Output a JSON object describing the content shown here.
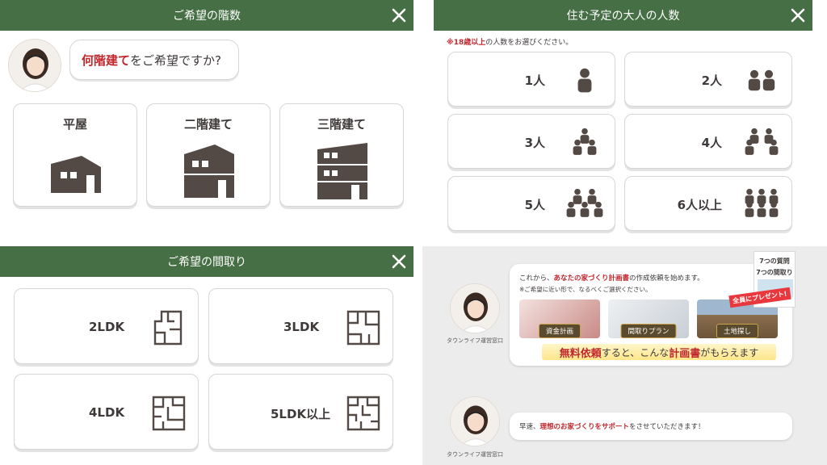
{
  "floors_panel": {
    "title": "ご希望の階数",
    "question_highlight": "何階建て",
    "question_rest": "をご希望ですか?",
    "options": [
      {
        "label": "平屋",
        "icon": "one-story-house-icon"
      },
      {
        "label": "二階建て",
        "icon": "two-story-house-icon"
      },
      {
        "label": "三階建て",
        "icon": "three-story-house-icon"
      }
    ]
  },
  "adults_panel": {
    "title": "住む予定の大人の人数",
    "note_highlight": "※18歳以上",
    "note_rest": "の人数をお選びください。",
    "options": [
      {
        "label": "1人",
        "count": 1
      },
      {
        "label": "2人",
        "count": 2
      },
      {
        "label": "3人",
        "count": 3
      },
      {
        "label": "4人",
        "count": 4
      },
      {
        "label": "5人",
        "count": 5
      },
      {
        "label": "6人以上",
        "count": 6
      }
    ]
  },
  "layout_panel": {
    "title": "ご希望の間取り",
    "options": [
      {
        "label": "2LDK"
      },
      {
        "label": "3LDK"
      },
      {
        "label": "4LDK"
      },
      {
        "label": "5LDK以上"
      }
    ]
  },
  "chat_panel": {
    "message1_pre": "これから、",
    "message1_highlight": "あなたの家づくり計画書",
    "message1_post": "の作成依頼を始めます。",
    "message1_note": "※ご希望に近い形で、なるべくご選択ください。",
    "photos": [
      {
        "label": "資金計画"
      },
      {
        "label": "間取りプラン"
      },
      {
        "label": "土地探し"
      }
    ],
    "banner_highlight1": "無料依頼",
    "banner_mid": "すると、こんな",
    "banner_highlight2": "計画書",
    "banner_end": "がもらえます",
    "book_line1": "7つの質問",
    "book_line2": "7つの間取り",
    "present_text": "全員にプレゼント!",
    "agent_caption": "タウンライフ運営窓口",
    "message2_pre": "早速、",
    "message2_highlight": "理想のお家づくりをサポート",
    "message2_post": "をさせていただきます！"
  },
  "colors": {
    "header_green": "#466f45",
    "icon_dark": "#544a45",
    "accent_red": "#c1272d",
    "panel_gray": "#ececec"
  }
}
